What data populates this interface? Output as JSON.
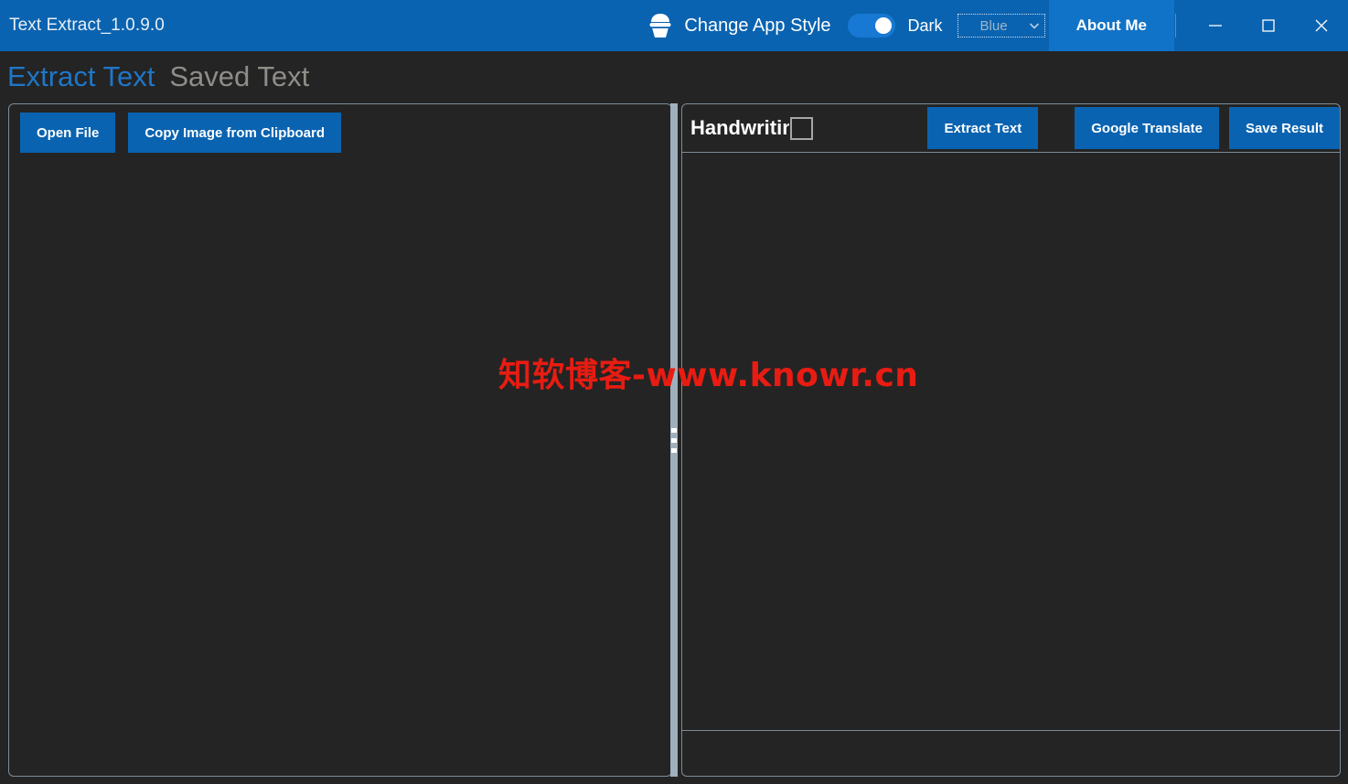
{
  "window": {
    "title": "Text Extract_1.0.9.0",
    "controls": {
      "minimize": "minimize-icon",
      "maximize": "maximize-icon",
      "close": "close-icon"
    }
  },
  "titlebar": {
    "style_icon": "cupcake-icon",
    "style_label": "Change App Style",
    "theme_toggle_state": "on",
    "theme_label": "Dark",
    "accent_combo": {
      "value": "Blue",
      "chevron": "chevron-down-icon"
    },
    "about_label": "About Me",
    "background_color": "#0a63b0",
    "accent_color": "#1173c7"
  },
  "tabs": [
    {
      "label": "Extract Text",
      "active": true,
      "color": "#1f76c8"
    },
    {
      "label": "Saved Text",
      "active": false,
      "color": "#8f8d88"
    }
  ],
  "left_panel": {
    "buttons": [
      {
        "label": "Open File"
      },
      {
        "label": "Copy Image from Clipboard"
      }
    ]
  },
  "right_panel": {
    "handwriting_label": "Handwriting",
    "handwriting_checked": false,
    "buttons": [
      {
        "label": "Extract Text"
      },
      {
        "label": "Google Translate"
      },
      {
        "label": "Save Result"
      }
    ]
  },
  "watermark": {
    "text": "知软博客-www.knowr.cn",
    "color": "#e81c12"
  }
}
